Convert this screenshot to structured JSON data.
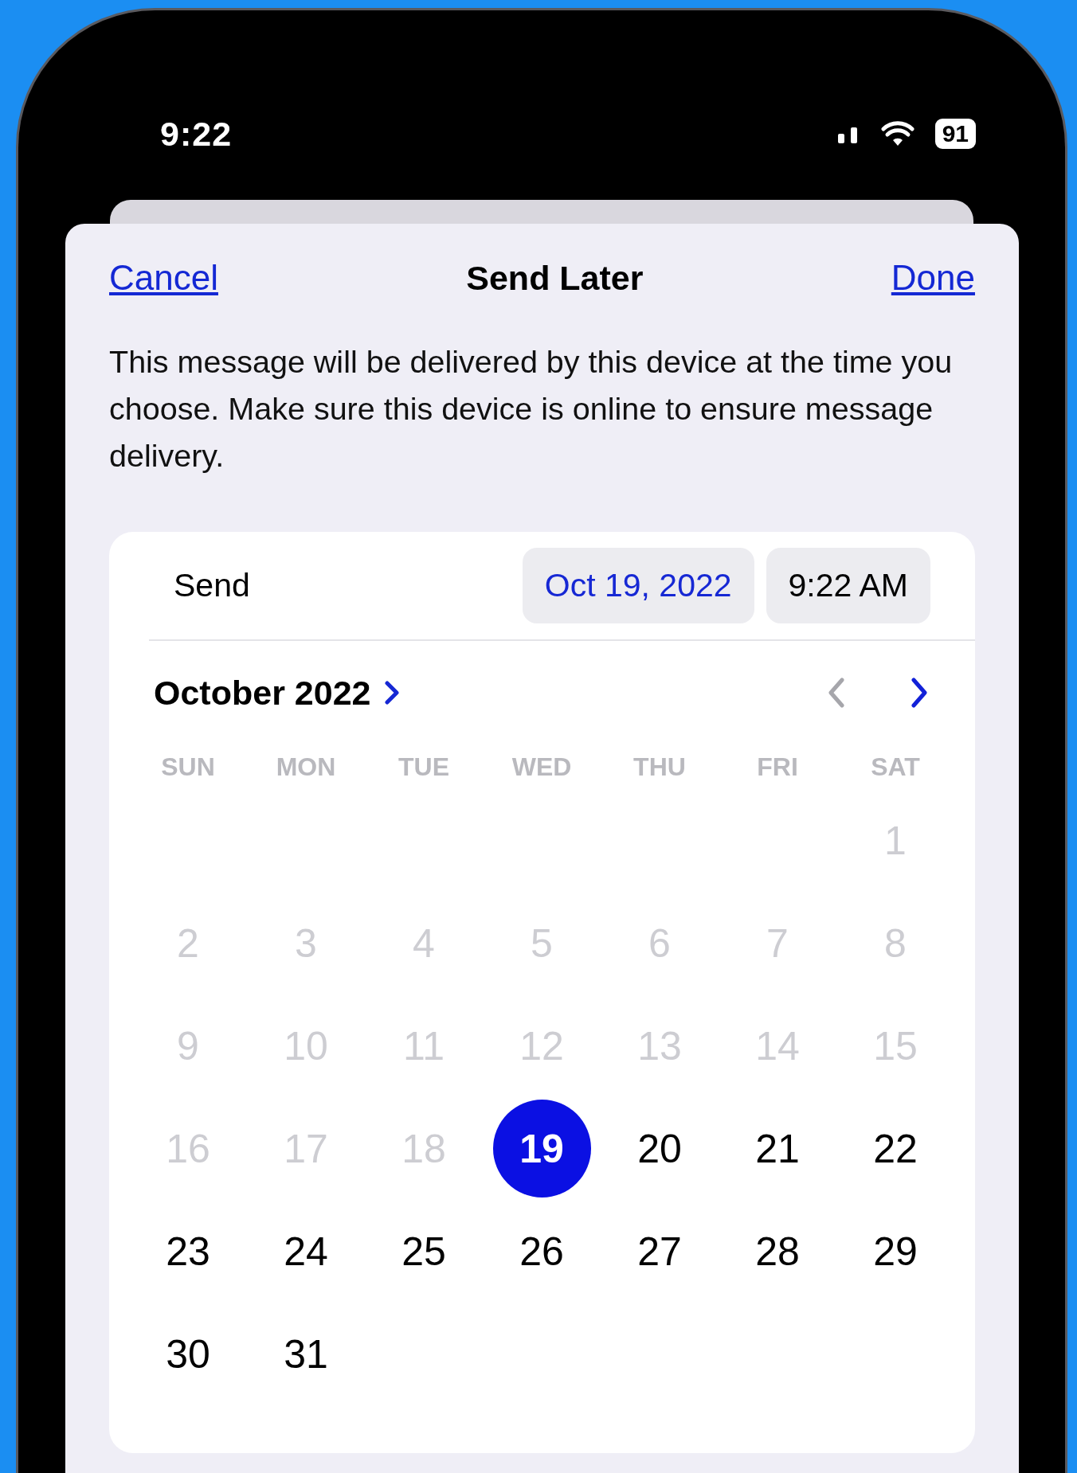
{
  "status_bar": {
    "time": "9:22",
    "battery": "91"
  },
  "sheet": {
    "cancel": "Cancel",
    "title": "Send Later",
    "done": "Done",
    "description": "This message will be delivered by this device at the time you choose. Make sure this device is online to ensure message delivery."
  },
  "send_row": {
    "label": "Send",
    "pills": [
      {
        "text": "Oct 19, 2022",
        "selected": true
      },
      {
        "text": "9:22 AM",
        "selected": false
      }
    ]
  },
  "calendar": {
    "month_title": "October 2022",
    "previous_disabled": true,
    "next_disabled": false,
    "weekdays": [
      "SUN",
      "MON",
      "TUE",
      "WED",
      "THU",
      "FRI",
      "SAT"
    ],
    "weeks": [
      {
        "days": [
          {
            "day": "1",
            "disabled": true,
            "selected": false
          }
        ]
      },
      {
        "days": [
          {
            "day": "2",
            "disabled": true,
            "selected": false
          },
          {
            "day": "3",
            "disabled": true,
            "selected": false
          },
          {
            "day": "4",
            "disabled": true,
            "selected": false
          },
          {
            "day": "5",
            "disabled": true,
            "selected": false
          },
          {
            "day": "6",
            "disabled": true,
            "selected": false
          },
          {
            "day": "7",
            "disabled": true,
            "selected": false
          },
          {
            "day": "8",
            "disabled": true,
            "selected": false
          }
        ]
      },
      {
        "days": [
          {
            "day": "9",
            "disabled": true,
            "selected": false
          },
          {
            "day": "10",
            "disabled": true,
            "selected": false
          },
          {
            "day": "11",
            "disabled": true,
            "selected": false
          },
          {
            "day": "12",
            "disabled": true,
            "selected": false
          },
          {
            "day": "13",
            "disabled": true,
            "selected": false
          },
          {
            "day": "14",
            "disabled": true,
            "selected": false
          },
          {
            "day": "15",
            "disabled": true,
            "selected": false
          }
        ]
      },
      {
        "days": [
          {
            "day": "16",
            "disabled": true,
            "selected": false
          },
          {
            "day": "17",
            "disabled": true,
            "selected": false
          },
          {
            "day": "18",
            "disabled": true,
            "selected": false
          },
          {
            "day": "19",
            "disabled": false,
            "selected": true
          },
          {
            "day": "20",
            "disabled": false,
            "selected": false
          },
          {
            "day": "21",
            "disabled": false,
            "selected": false
          },
          {
            "day": "22",
            "disabled": false,
            "selected": false
          }
        ]
      },
      {
        "days": [
          {
            "day": "23",
            "disabled": false,
            "selected": false
          },
          {
            "day": "24",
            "disabled": false,
            "selected": false
          },
          {
            "day": "25",
            "disabled": false,
            "selected": false
          },
          {
            "day": "26",
            "disabled": false,
            "selected": false
          },
          {
            "day": "27",
            "disabled": false,
            "selected": false
          },
          {
            "day": "28",
            "disabled": false,
            "selected": false
          },
          {
            "day": "29",
            "disabled": false,
            "selected": false
          }
        ]
      },
      {
        "days": [
          {
            "day": "30",
            "disabled": false,
            "selected": false
          },
          {
            "day": "31",
            "disabled": false,
            "selected": false
          }
        ]
      }
    ]
  }
}
